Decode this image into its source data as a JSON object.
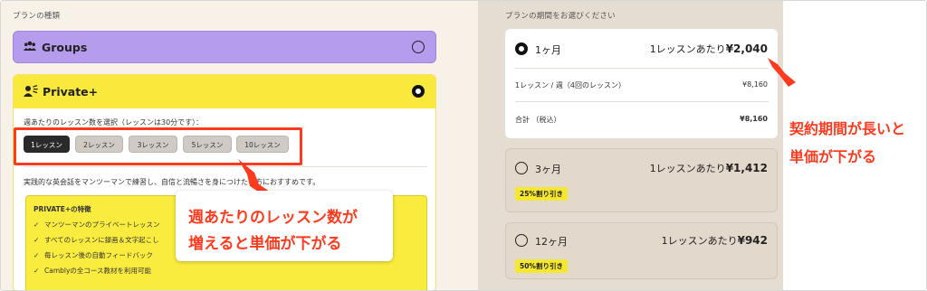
{
  "colors": {
    "left_bg": "#f8f1e8",
    "right_bg": "#e6ddd2",
    "groups_purple": "#b59ced",
    "private_yellow": "#f9e93c",
    "annotation_red": "#ff3b1f"
  },
  "plan_type": {
    "section_label": "プランの種類",
    "groups": {
      "icon": "group-icon",
      "title": "Groups"
    },
    "private": {
      "icon": "private-person-icon",
      "title": "Private+",
      "select_label": "週あたりのレッスン数を選択（レッスンは30分です）：",
      "counts": [
        "1レッスン",
        "2レッスン",
        "3レッスン",
        "5レッスン",
        "10レッスン"
      ],
      "selected_count": "1レッスン",
      "description": "実践的な英会話をマンツーマンで練習し、自信と流暢さを身につけたい方におすすめです。",
      "features_title": "PRIVATE+の特徴",
      "features": [
        "マンツーマンのプライベートレッスン",
        "すべてのレッスンに録画＆文字起こし",
        "毎レッスン後の自動フィードバック",
        "Camblyの全コース教材を利用可能"
      ]
    }
  },
  "period": {
    "section_label": "プランの期間をお選びください",
    "plans": [
      {
        "label": "1ヶ月",
        "per_lesson_text": "1レッスンあたり",
        "per_lesson_price": "¥2,040",
        "selected": true
      },
      {
        "label": "3ヶ月",
        "per_lesson_text": "1レッスンあたり",
        "per_lesson_price": "¥1,412",
        "discount": "25%割り引き"
      },
      {
        "label": "12ヶ月",
        "per_lesson_text": "1レッスンあたり",
        "per_lesson_price": "¥942",
        "discount": "50%割り引き"
      }
    ],
    "details": {
      "lessons_per_week_label": "1レッスン / 週（4回のレッスン）",
      "lessons_per_week_price": "¥8,160",
      "total_label": "合計 （税込）",
      "total_price": "¥8,160"
    }
  },
  "annotations": {
    "left_callout_line1": "週あたりのレッスン数が",
    "left_callout_line2": "増えると単価が下がる",
    "right_line1": "契約期間が長いと",
    "right_line2": "単価が下がる"
  }
}
